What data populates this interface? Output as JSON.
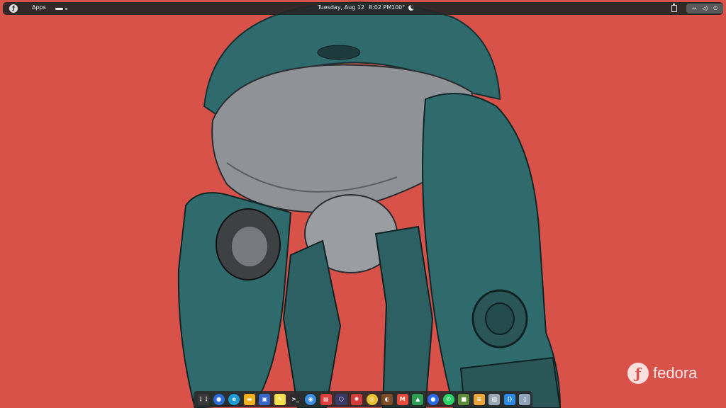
{
  "topbar": {
    "apps_label": "Apps",
    "date": "Tuesday, Aug 12",
    "time": "8:02 PM",
    "temperature": "100°",
    "activities_icon": "fedora-logo-icon",
    "weather_icon": "moon-icon",
    "clipboard_icon": "clipboard-icon",
    "system_icons": [
      "network-icon",
      "volume-icon",
      "power-icon"
    ]
  },
  "watermark": {
    "text": "fedora"
  },
  "dock": {
    "apps": [
      {
        "name": "app-grid",
        "color": "#3a3a3a",
        "glyph": "⋮⋮"
      },
      {
        "name": "firefox",
        "color": "#2a6dd9",
        "glyph": "●"
      },
      {
        "name": "edge",
        "color": "#1b9ad6",
        "glyph": "e"
      },
      {
        "name": "files",
        "color": "#f2b01e",
        "glyph": "▬"
      },
      {
        "name": "software-center",
        "color": "#3566c8",
        "glyph": "▣"
      },
      {
        "name": "text-editor",
        "color": "#f4e04d",
        "glyph": "✎"
      },
      {
        "name": "terminal",
        "color": "#2b2b2b",
        "glyph": ">_"
      },
      {
        "name": "settings",
        "color": "#3b8fe0",
        "glyph": "◉"
      },
      {
        "name": "screenshot",
        "color": "#e03d3d",
        "glyph": "▤"
      },
      {
        "name": "rustdesk",
        "color": "#3a3a6a",
        "glyph": "⬡"
      },
      {
        "name": "pinwheel",
        "color": "#d43a3a",
        "glyph": "✺"
      },
      {
        "name": "chrome",
        "color": "#e6c02c",
        "glyph": "◎"
      },
      {
        "name": "sync-tool",
        "color": "#7d4b24",
        "glyph": "◐"
      },
      {
        "name": "gmail",
        "color": "#e54a3a",
        "glyph": "M"
      },
      {
        "name": "drive",
        "color": "#2e9e54",
        "glyph": "▲"
      },
      {
        "name": "signal",
        "color": "#2c6bed",
        "glyph": "●"
      },
      {
        "name": "whatsapp",
        "color": "#25d366",
        "glyph": "✆"
      },
      {
        "name": "minecraft",
        "color": "#5b8c3a",
        "glyph": "■"
      },
      {
        "name": "stack-app",
        "color": "#e8a33a",
        "glyph": "≡"
      },
      {
        "name": "image-viewer",
        "color": "#9aa7b4",
        "glyph": "▨"
      },
      {
        "name": "vscode",
        "color": "#2b8ae6",
        "glyph": "⟨⟩"
      },
      {
        "name": "trash",
        "color": "#8fa3b8",
        "glyph": "▯"
      }
    ]
  }
}
